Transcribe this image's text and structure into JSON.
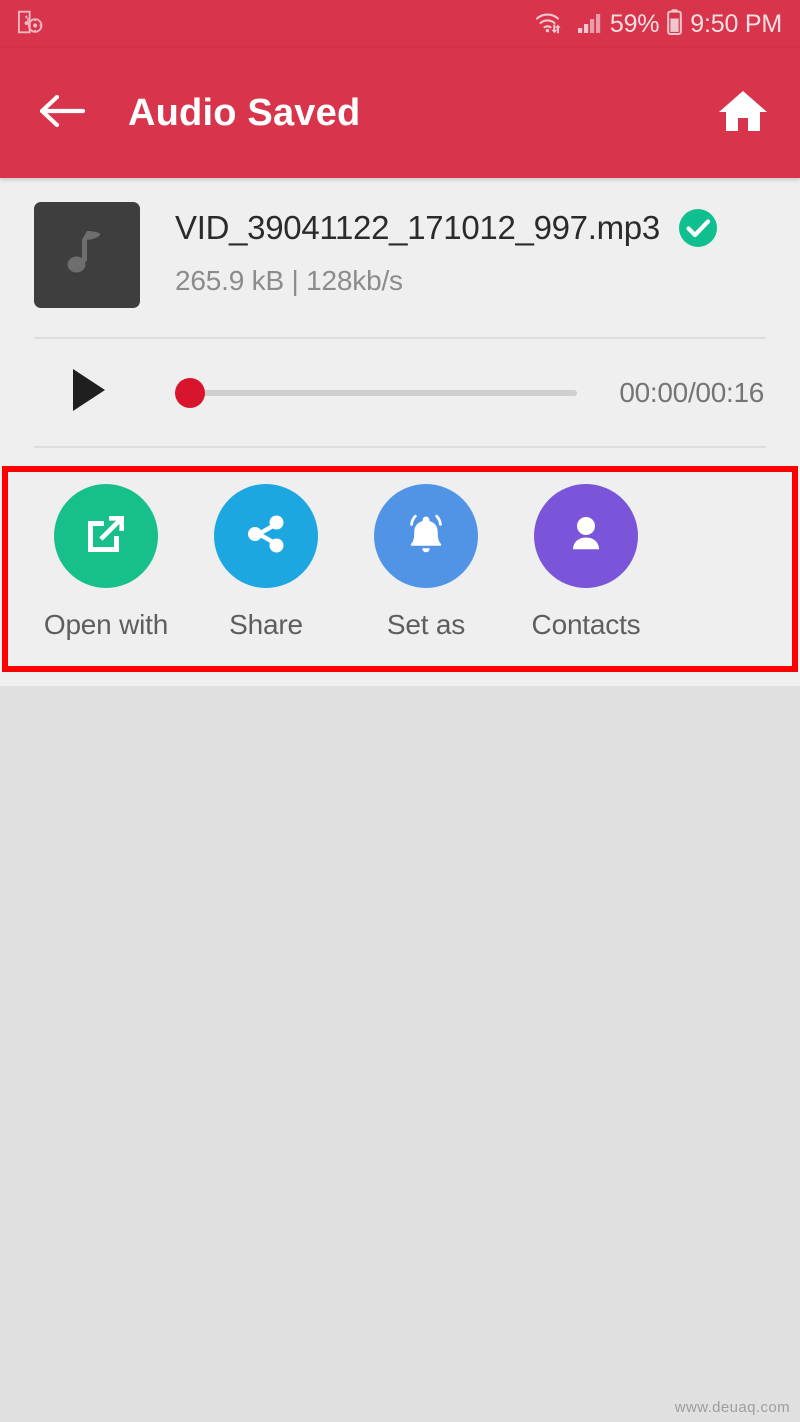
{
  "status_bar": {
    "notification_icon": "music-note-notification-icon",
    "wifi_icon": "wifi-data-transfer-icon",
    "signal_icon": "cellular-signal-icon",
    "battery_percent": "59%",
    "battery_icon": "battery-icon",
    "time": "9:50 PM"
  },
  "app_bar": {
    "back_icon": "back-arrow-icon",
    "title": "Audio Saved",
    "home_icon": "home-icon",
    "background_color": "#d8344b"
  },
  "file": {
    "thumbnail_icon": "music-note-icon",
    "name": "VID_39041122_171012_997.mp3",
    "status_icon": "check-circle-icon",
    "status_color": "#0fbf8e",
    "details": "265.9 kB | 128kb/s"
  },
  "player": {
    "play_icon": "play-icon",
    "progress_percent": 0,
    "thumb_color": "#d9152e",
    "track_color": "#cfcfcf",
    "time": "00:00/00:16"
  },
  "actions": [
    {
      "label": "Open with",
      "icon": "open-in-new-icon",
      "color": "#17c08a"
    },
    {
      "label": "Share",
      "icon": "share-icon",
      "color": "#1ca7e0"
    },
    {
      "label": "Set as",
      "icon": "bell-ring-icon",
      "color": "#5194e5"
    },
    {
      "label": "Contacts",
      "icon": "person-icon",
      "color": "#7a55d9"
    }
  ],
  "annotation": {
    "shape": "rectangle-highlight",
    "color": "#ff0000"
  },
  "watermark": {
    "text": "www.deuaq.com"
  }
}
